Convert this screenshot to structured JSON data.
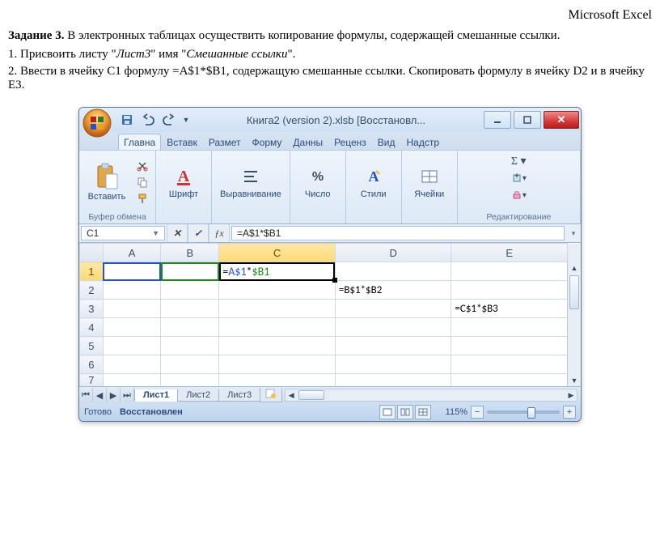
{
  "doc": {
    "app_name": "Microsoft Excel",
    "task_label": "Задание 3.",
    "task_text": " В электронных таблицах осуществить копирование формулы, содержащей смешанные ссылки.",
    "step1_prefix": "1. Присвоить листу \"",
    "step1_italic1": "Лист3",
    "step1_mid": "\" имя \"",
    "step1_italic2": "Смешанные ссылки",
    "step1_suffix": "\".",
    "step2": "2. Ввести в ячейку C1 формулу =A$1*$B1, содержащую смешанные ссылки. Скопировать формулу в ячейку D2 и в ячейку E3."
  },
  "excel": {
    "title": "Книга2 (version 2).xlsb [Восстановл...",
    "tabs": [
      "Главна",
      "Вставк",
      "Размет",
      "Форму",
      "Данны",
      "Реценз",
      "Вид",
      "Надстр"
    ],
    "active_tab": 0,
    "groups": {
      "clipboard": "Буфер обмена",
      "paste": "Вставить",
      "font": "Шрифт",
      "align": "Выравнивание",
      "number": "Число",
      "styles": "Стили",
      "cells": "Ячейки",
      "editing": "Редактирование"
    },
    "namebox": "C1",
    "formula": "=A$1*$B1",
    "columns": [
      "A",
      "B",
      "C",
      "D",
      "E"
    ],
    "rows": [
      "1",
      "2",
      "3",
      "4",
      "5",
      "6",
      "7"
    ],
    "cells": {
      "C1": {
        "eq": "=",
        "ref1": "A$1",
        "op": "*",
        "ref2": "$B1"
      },
      "D2": "=B$1*$B2",
      "E3": "=C$1*$B3"
    },
    "sheets": [
      "Лист1",
      "Лист2",
      "Лист3"
    ],
    "active_sheet": 0,
    "status_ready": "Готово",
    "status_recovered": "Восстановлен",
    "zoom": "115%"
  }
}
